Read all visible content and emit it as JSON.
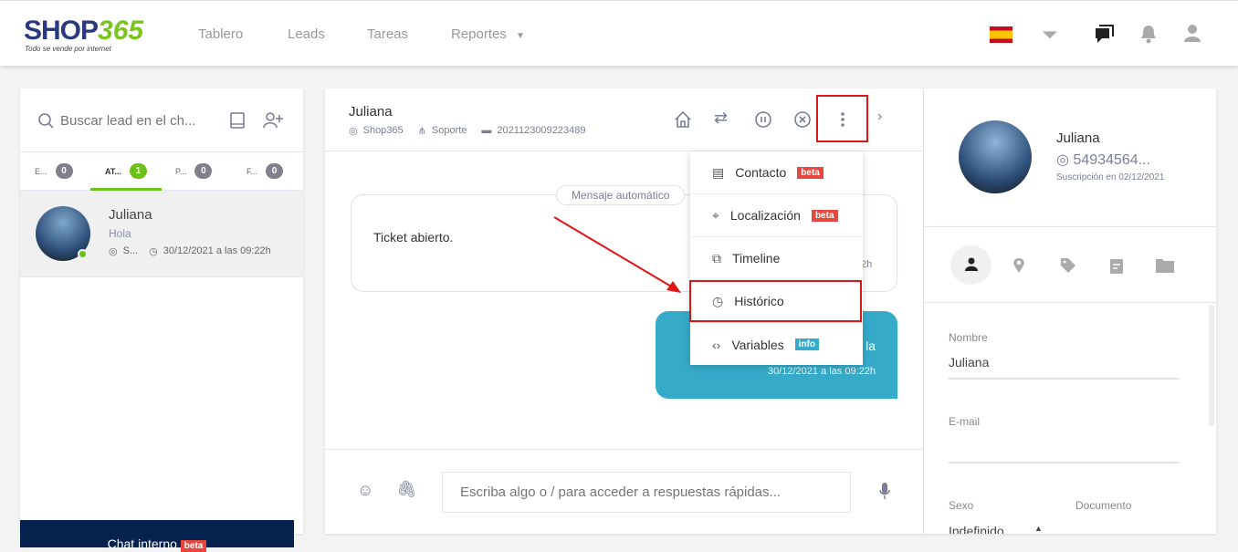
{
  "header": {
    "logo_text": "SHOP365",
    "logo_tagline": "Todo se vende por internet",
    "nav": [
      "Tablero",
      "Leads",
      "Tareas",
      "Reportes"
    ],
    "icons": [
      "spain-flag-icon",
      "funnel-dollar-icon",
      "chat-icon",
      "bell-icon",
      "user-icon"
    ]
  },
  "left": {
    "search_placeholder": "Buscar lead en el ch...",
    "tabs": [
      {
        "label": "E...",
        "count": "0"
      },
      {
        "label": "AT...",
        "count": "1"
      },
      {
        "label": "P...",
        "count": "0"
      },
      {
        "label": "F...",
        "count": "0"
      }
    ],
    "leads": [
      {
        "name": "Juliana",
        "message": "Hola",
        "channel": "S...",
        "time": "30/12/2021 a las 09:22h"
      }
    ],
    "chat_interno": "Chat interno",
    "chat_interno_badge": "beta"
  },
  "chat": {
    "name": "Juliana",
    "channel": "Shop365",
    "department": "Soporte",
    "ticket": "2021123009223489",
    "auto_label": "Mensaje automático",
    "auto_text": "Ticket abierto.",
    "auto_time_partial": "2h",
    "out_text_partial": "la",
    "out_time": "30/12/2021 a las 09:22h",
    "input_placeholder": "Escriba algo o / para acceder a respuestas rápidas..."
  },
  "menu": [
    {
      "label": "Contacto",
      "badge": "beta"
    },
    {
      "label": "Localización",
      "badge": "beta"
    },
    {
      "label": "Timeline"
    },
    {
      "label": "Histórico"
    },
    {
      "label": "Variables",
      "badge": "info"
    }
  ],
  "contact": {
    "name": "Juliana",
    "phone": "54934564...",
    "subscription": "Suscripción en 02/12/2021",
    "fields": {
      "nombre_label": "Nombre",
      "nombre_value": "Juliana",
      "email_label": "E-mail",
      "email_value": "",
      "sexo_label": "Sexo",
      "sexo_value": "Indefinido",
      "documento_label": "Documento"
    }
  },
  "colors": {
    "accent_green": "#6cc01a",
    "teal": "#35abc9",
    "navy": "#06224f",
    "badge_red": "#e8473d",
    "highlight_red": "#e01515"
  }
}
